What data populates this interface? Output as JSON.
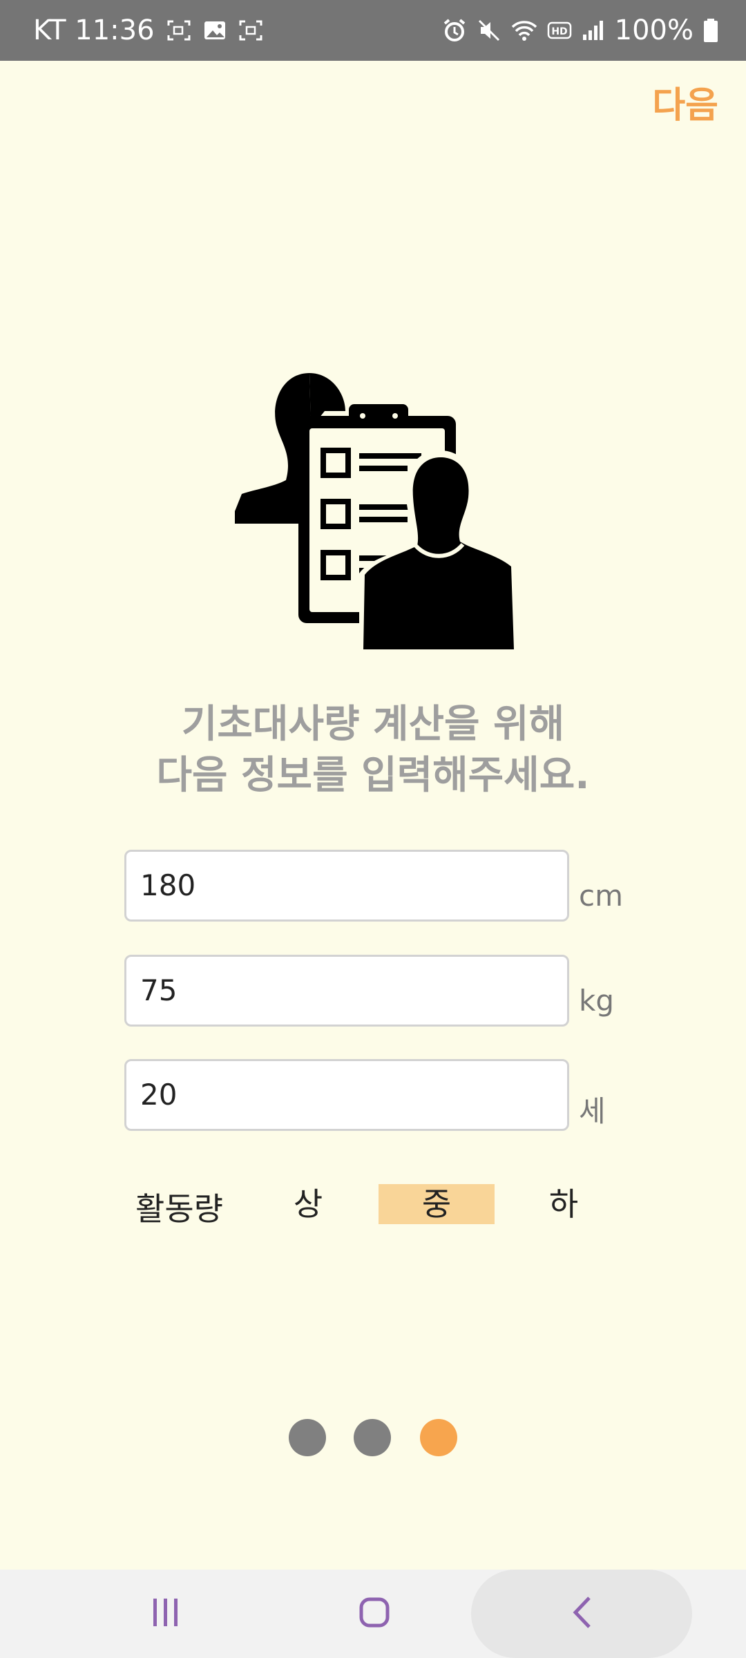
{
  "status_bar": {
    "carrier_time": "KT 11:36",
    "battery": "100%",
    "icons": [
      "screen-record-icon",
      "gallery-icon",
      "screenshot-icon",
      "alarm-icon",
      "mute-icon",
      "wifi-icon",
      "hd-voice-icon",
      "signal-icon",
      "battery-icon"
    ]
  },
  "header": {
    "next_label": "다음"
  },
  "illustration": {
    "icon": "clipboard-users-icon"
  },
  "instruction": {
    "line1": "기초대사량 계산을 위해",
    "line2": "다음 정보를 입력해주세요."
  },
  "fields": {
    "height": {
      "value": "180",
      "unit": "cm"
    },
    "weight": {
      "value": "75",
      "unit": "kg"
    },
    "age": {
      "value": "20",
      "unit": "세"
    }
  },
  "activity": {
    "label": "활동량",
    "options": [
      "상",
      "중",
      "하"
    ],
    "selected": "중"
  },
  "pager": {
    "total": 3,
    "current": 3,
    "active_color": "#F7A54E",
    "inactive_color": "#808080"
  },
  "colors": {
    "accent": "#F4A24E",
    "background": "#FDFCE8",
    "selected_bg": "#F9D598"
  },
  "nav_bar": {
    "icons": [
      "recent-apps-icon",
      "home-icon",
      "back-icon"
    ]
  }
}
